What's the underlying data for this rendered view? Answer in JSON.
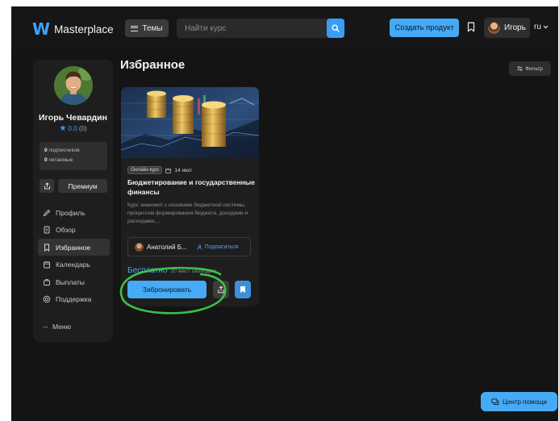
{
  "header": {
    "logo_mark": "W",
    "app_name": "Masterplace",
    "themes_label": "Темы",
    "search_placeholder": "Найти курс",
    "create_label": "Создать продукт",
    "user_name": "Игорь",
    "language": "ru"
  },
  "sidebar": {
    "name": "Игорь Чевардин",
    "rating_value": "0.0",
    "rating_count": "(0)",
    "followers_count": "0",
    "followers_label": "подписчиков",
    "readers_count": "0",
    "readers_label": "читаемые",
    "premium_label": "Премиум",
    "nav": [
      {
        "label": "Профиль",
        "icon": "pencil-icon"
      },
      {
        "label": "Обзор",
        "icon": "document-icon"
      },
      {
        "label": "Избранное",
        "icon": "bookmark-icon",
        "active": true
      },
      {
        "label": "Календарь",
        "icon": "calendar-icon"
      },
      {
        "label": "Выплаты",
        "icon": "wallet-icon"
      },
      {
        "label": "Поддержка",
        "icon": "support-icon"
      }
    ],
    "menu_label": "Меню"
  },
  "main": {
    "title": "Избранное",
    "filter_label": "Фильтр"
  },
  "card": {
    "tag": "Онлайн-курс",
    "date": "14 июл",
    "title": "Бюджетирование и государственные финансы",
    "description": "Курс знакомит с основами бюджетной системы, процессом формирования бюджета, доходами и расходами,...",
    "author": "Анатолий Б...",
    "subscribe_label": "Подписаться",
    "price": "Бесплатно",
    "seats": "20 мест свободно",
    "book_label": "Забронировать"
  },
  "help_label": "Центр помощи",
  "colors": {
    "accent": "#45a9f4",
    "background": "#141414",
    "panel": "#1e1e1e",
    "highlight_ring": "#3fd24a"
  }
}
